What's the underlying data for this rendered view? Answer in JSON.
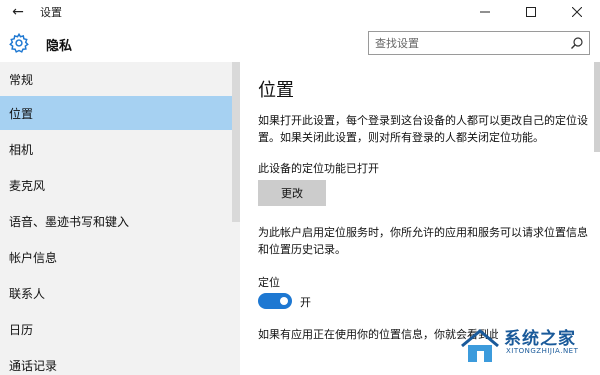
{
  "window": {
    "back_glyph": "←",
    "title": "设置",
    "minimize_icon": "minimize-icon",
    "maximize_icon": "maximize-icon",
    "close_icon": "close-icon"
  },
  "header": {
    "icon": "gear-icon",
    "title": "隐私",
    "search_placeholder": "查找设置"
  },
  "sidebar": {
    "items": [
      {
        "label": "常规",
        "active": false
      },
      {
        "label": "位置",
        "active": true
      },
      {
        "label": "相机",
        "active": false
      },
      {
        "label": "麦克风",
        "active": false
      },
      {
        "label": "语音、墨迹书写和键入",
        "active": false
      },
      {
        "label": "帐户信息",
        "active": false
      },
      {
        "label": "联系人",
        "active": false
      },
      {
        "label": "日历",
        "active": false
      },
      {
        "label": "通话记录",
        "active": false
      }
    ]
  },
  "main": {
    "title": "位置",
    "intro": "如果打开此设置，每个登录到这台设备的人都可以更改自己的定位设置。如果关闭此设置，则对所有登录的人都关闭定位功能。",
    "device_status": "此设备的定位功能已打开",
    "change_button": "更改",
    "account_desc": "为此帐户启用定位服务时，你所允许的应用和服务可以请求位置信息和位置历史记录。",
    "location_label": "定位",
    "toggle_state": "开",
    "toggle_on": true,
    "bottom_text": "如果有应用正在使用你的位置信息，你就会看到此图标"
  },
  "watermark": {
    "text": "系统之家",
    "url": "XITONGZHIJIA.NET"
  },
  "colors": {
    "accent": "#1e78d2",
    "sidebar_bg": "#f2f2f2",
    "sidebar_active": "#a6d1f2",
    "button_bg": "#cccccc"
  }
}
